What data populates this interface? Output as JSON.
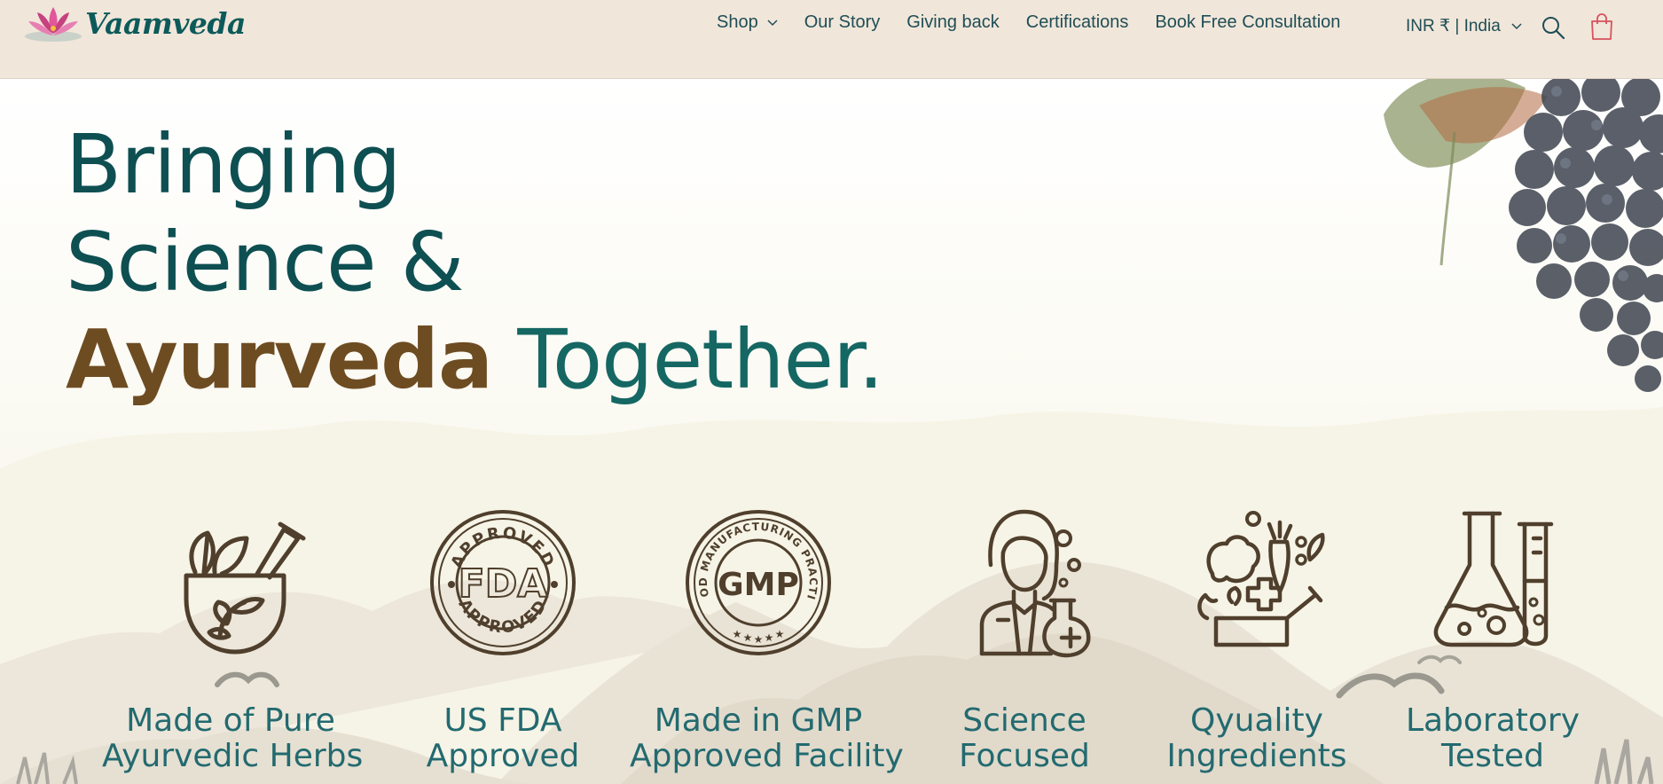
{
  "header": {
    "logo_text": "Vaamveda",
    "nav": [
      {
        "label": "Shop"
      },
      {
        "label": "Our Story"
      },
      {
        "label": "Giving back"
      },
      {
        "label": "Certifications"
      },
      {
        "label": "Book Free Consultation"
      }
    ],
    "currency": "INR ₹ | India",
    "icons": [
      "lotus-logo-icon",
      "chevron-down-icon",
      "search-icon",
      "cart-icon"
    ]
  },
  "hero": {
    "headline": {
      "line1": "Bringing",
      "line2": "Science &",
      "line3_accent": "Ayurveda",
      "line3_rest": " Together."
    },
    "features": [
      {
        "label_1": "Made of Pure",
        "label_2": "Ayurvedic Herbs",
        "icon": "mortar-herbs-icon"
      },
      {
        "label_1": "US FDA",
        "label_2": "Approved",
        "icon": "fda-approved-seal-icon",
        "seal_text": "FDA",
        "ring_text": "APPROVED"
      },
      {
        "label_1": "Made in GMP",
        "label_2": "Approved Facility",
        "icon": "gmp-seal-icon",
        "seal_text": "GMP",
        "ring_text": "GOOD MANUFACTURING PRACTICE"
      },
      {
        "label_1": "Science",
        "label_2": "Focused",
        "icon": "scientist-icon"
      },
      {
        "label_1": "Qyuality",
        "label_2": "Ingredients",
        "icon": "ingredients-icon"
      },
      {
        "label_1": "Laboratory",
        "label_2": "Tested",
        "icon": "lab-flask-icon"
      }
    ]
  },
  "colors": {
    "header_bg": "#f1e6da",
    "primary_teal": "#0e4f52",
    "accent_brown": "#6e4c22",
    "icon_brown": "#4f3f2c",
    "cart_red": "#d8525c"
  }
}
